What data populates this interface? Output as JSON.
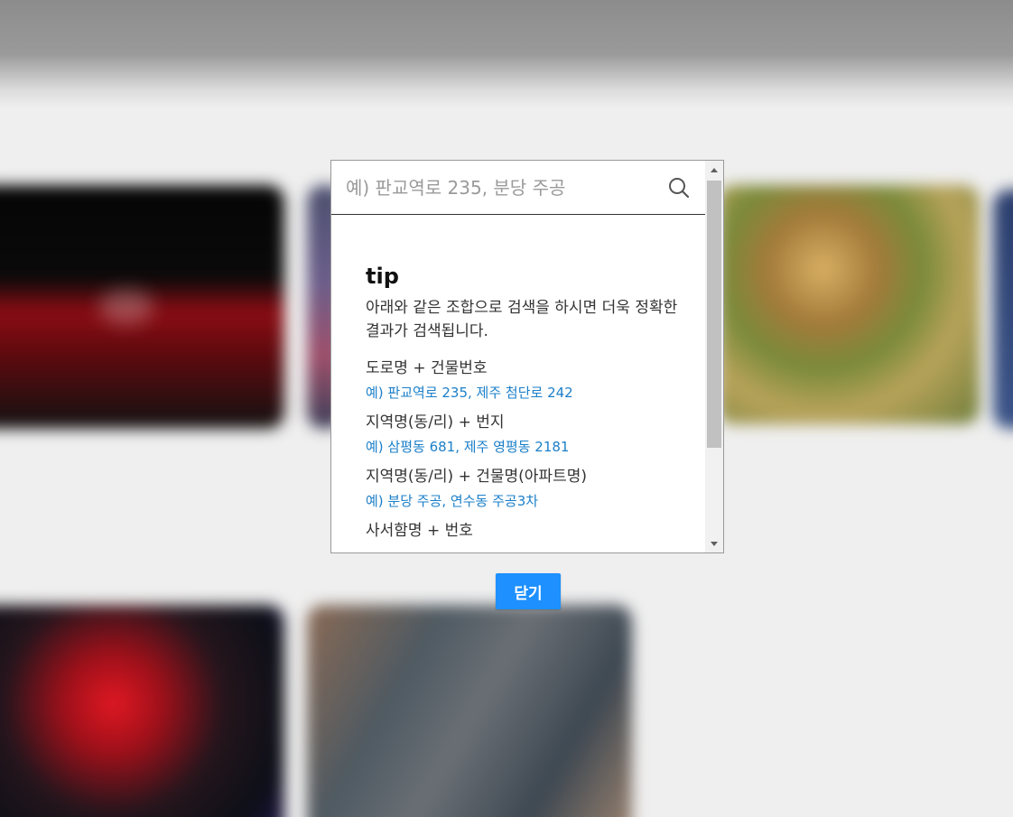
{
  "search": {
    "placeholder": "예) 판교역로 235, 분당 주공",
    "value": ""
  },
  "tip": {
    "title": "tip",
    "description": "아래와 같은 조합으로 검색을 하시면 더욱 정확한 결과가 검색됩니다.",
    "items": [
      {
        "label": "도로명 + 건물번호",
        "example": "예) 판교역로 235,  제주 첨단로 242"
      },
      {
        "label": "지역명(동/리) + 번지",
        "example": "예) 삼평동 681,  제주 영평동 2181"
      },
      {
        "label": "지역명(동/리) + 건물명(아파트명)",
        "example": "예) 분당 주공,  연수동 주공3차"
      },
      {
        "label": "사서함명 + 번호",
        "example": ""
      }
    ]
  },
  "close_label": "닫기",
  "colors": {
    "accent": "#1e90ff",
    "example_text": "#1b7fc9"
  },
  "icons": {
    "search": "search-icon",
    "scroll_up": "triangle-up-icon",
    "scroll_down": "triangle-down-icon"
  }
}
